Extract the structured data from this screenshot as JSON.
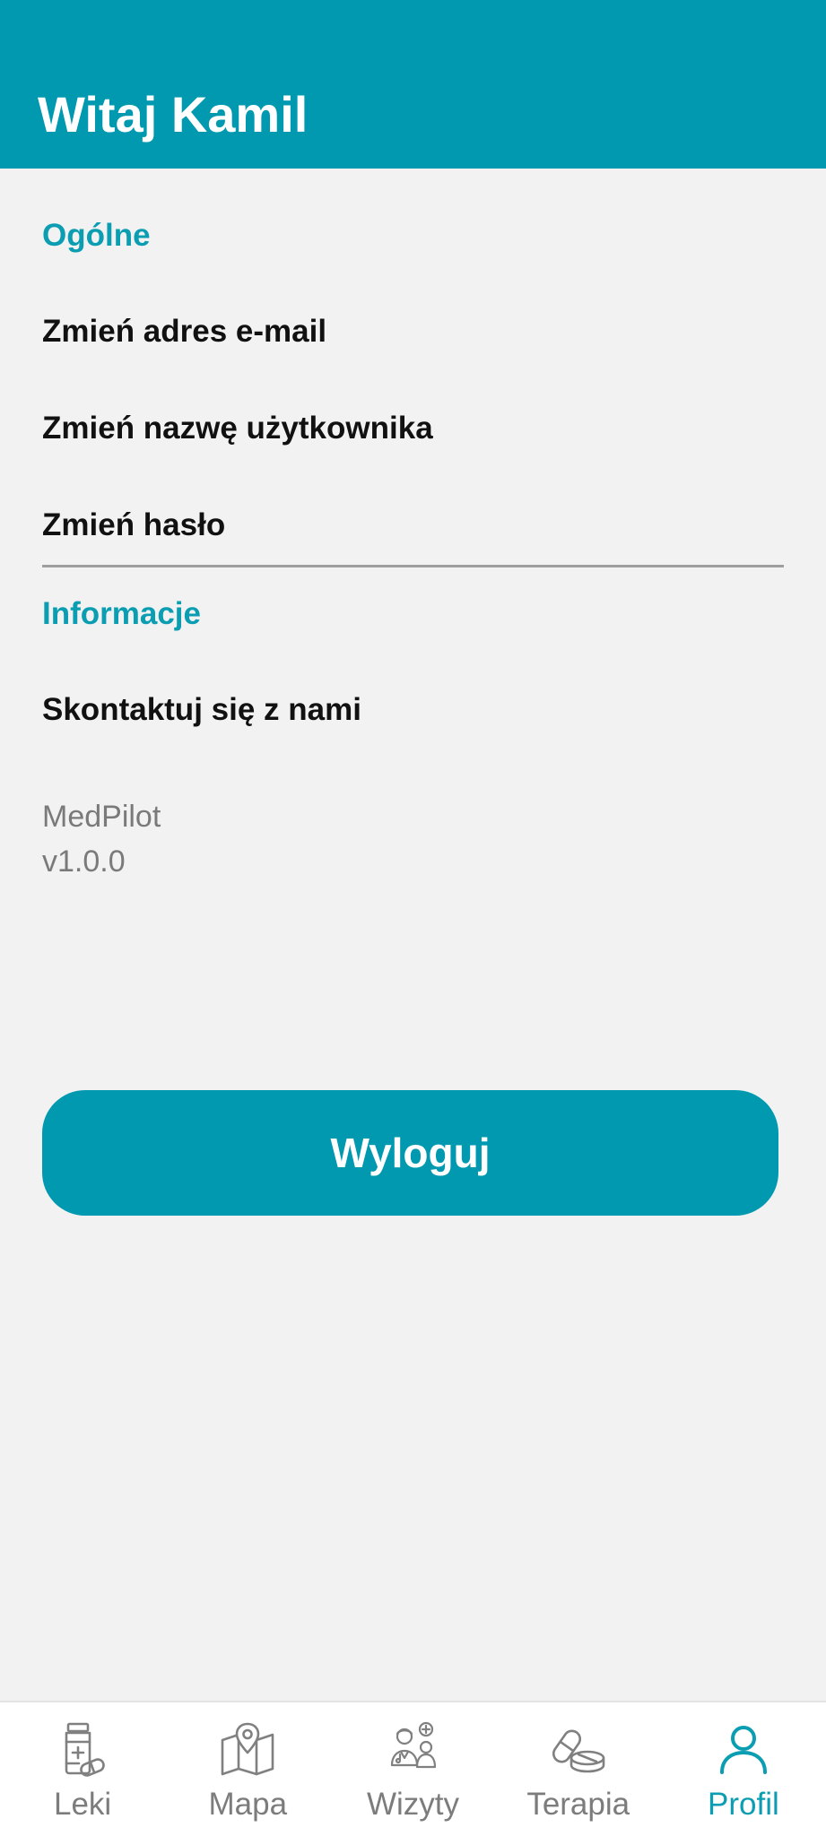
{
  "header": {
    "title": "Witaj Kamil"
  },
  "sections": {
    "general": {
      "title": "Ogólne",
      "items": [
        "Zmień adres e-mail",
        "Zmień nazwę użytkownika",
        "Zmień hasło"
      ]
    },
    "info": {
      "title": "Informacje",
      "items": [
        "Skontaktuj się z nami"
      ]
    }
  },
  "app_info": {
    "name": "MedPilot",
    "version": "v1.0.0"
  },
  "logout": {
    "label": "Wyloguj"
  },
  "bottom_nav": {
    "active": "Profil",
    "items": [
      {
        "label": "Leki",
        "icon": "medicine-bottle-icon"
      },
      {
        "label": "Mapa",
        "icon": "map-pin-icon"
      },
      {
        "label": "Wizyty",
        "icon": "doctor-icon"
      },
      {
        "label": "Terapia",
        "icon": "pills-icon"
      },
      {
        "label": "Profil",
        "icon": "user-icon"
      }
    ]
  },
  "colors": {
    "accent": "#0099b0",
    "section_title": "#0b9db2",
    "background": "#f2f2f2",
    "muted_text": "#7a7a7a"
  }
}
